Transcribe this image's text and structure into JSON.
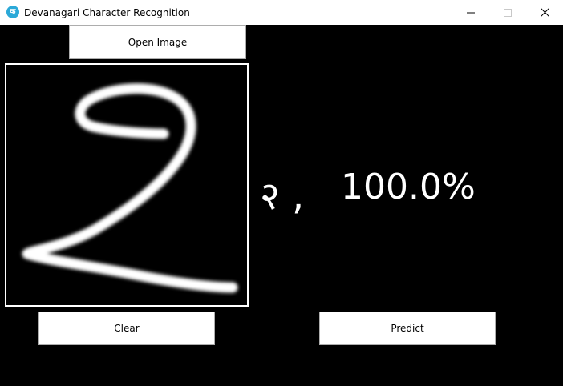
{
  "window": {
    "title": "Devanagari Character Recognition",
    "icon": "app-icon",
    "controls": [
      "minimize-icon",
      "maximize-icon",
      "close-icon"
    ]
  },
  "buttons": {
    "open_label": "Open Image",
    "clear_label": "Clear",
    "predict_label": "Predict"
  },
  "prediction": {
    "character": "२",
    "separator": ",",
    "confidence": "100.0%"
  },
  "colors": {
    "background": "#000000",
    "titlebar": "#ffffff",
    "stroke": "#ffffff",
    "button_face": "#ffffff",
    "app_icon": "#2ba9d8"
  }
}
